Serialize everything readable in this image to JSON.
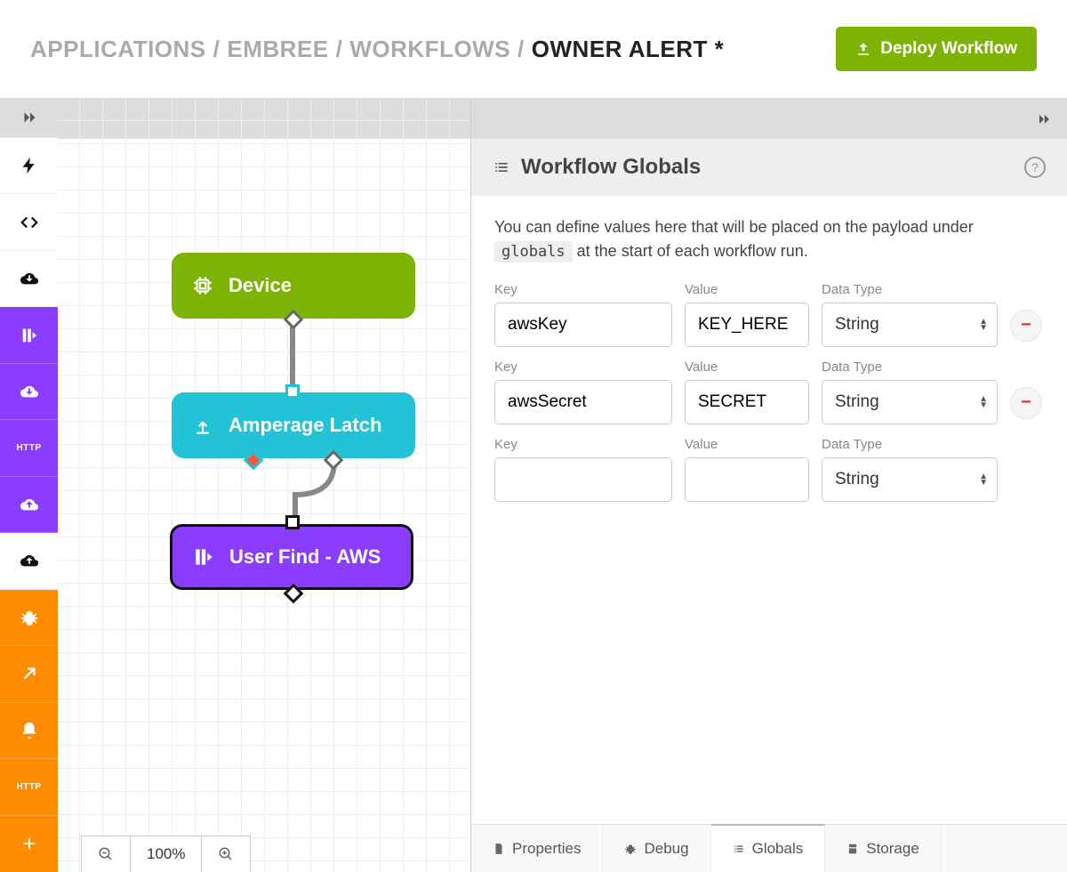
{
  "breadcrumb": {
    "items": [
      "APPLICATIONS",
      "EMBREE",
      "WORKFLOWS"
    ],
    "current": "OWNER ALERT *"
  },
  "deploy_button": "Deploy Workflow",
  "rail": {
    "http_label": "HTTP"
  },
  "canvas": {
    "nodes": {
      "device": "Device",
      "amperage": "Amperage Latch",
      "userfind": "User Find - AWS"
    },
    "zoom_level": "100%"
  },
  "panel": {
    "title": "Workflow Globals",
    "description_pre": "You can define values here that will be placed on the payload under ",
    "description_code": "globals",
    "description_post": " at the start of each workflow run.",
    "labels": {
      "key": "Key",
      "value": "Value",
      "type": "Data Type"
    },
    "rows": [
      {
        "key": "awsKey",
        "value": "KEY_HERE",
        "type": "String",
        "removable": true
      },
      {
        "key": "awsSecret",
        "value": "SECRET",
        "type": "String",
        "removable": true
      },
      {
        "key": "",
        "value": "",
        "type": "String",
        "removable": false
      }
    ]
  },
  "tabs": {
    "properties": "Properties",
    "debug": "Debug",
    "globals": "Globals",
    "storage": "Storage"
  }
}
